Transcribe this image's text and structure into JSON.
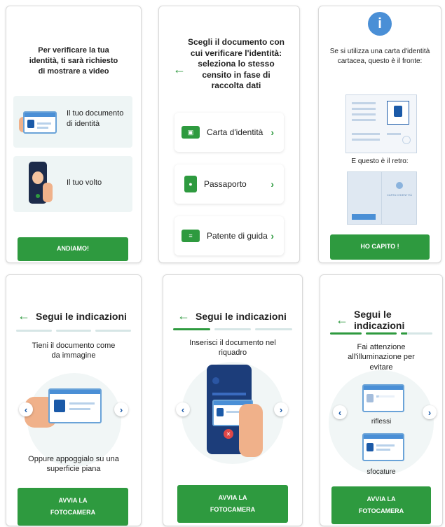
{
  "screens": {
    "s1": {
      "intro": "Per verificare la tua identità, ti sarà richiesto di mostrare a video",
      "item1": "Il tuo documento di identità",
      "item2": "Il tuo volto",
      "button": "ANDIAMO!"
    },
    "s2": {
      "title": "Scegli il documento con cui verificare l'identità: seleziona lo stesso censito in fase di raccolta dati",
      "docs": [
        "Carta d'identità",
        "Passaporto",
        "Patente di guida"
      ]
    },
    "s3": {
      "info_icon": "i",
      "text_front": "Se si utilizza una carta d'identità cartacea, questo è il fronte:",
      "text_back": "E questo è il retro:",
      "back_card_label": "CARTA D'IDENTITÀ",
      "button": "HO CAPITO !"
    },
    "s4": {
      "header": "Segui le indicazioni",
      "text1": "Tieni il documento come da immagine",
      "text2": "Oppure appoggialo su una superficie piana",
      "button_line1": "AVVIA LA",
      "button_line2": "FOTOCAMERA"
    },
    "s5": {
      "header": "Segui le indicazioni",
      "text1": "Inserisci il documento nel riquadro",
      "button_line1": "AVVIA LA",
      "button_line2": "FOTOCAMERA"
    },
    "s6": {
      "header": "Segui le indicazioni",
      "text1": "Fai attenzione all'illuminazione per evitare",
      "label1": "riflessi",
      "label2": "sfocature",
      "button_line1": "AVVIA LA",
      "button_line2": "FOTOCAMERA"
    }
  },
  "icons": {
    "back": "←",
    "chevron": "›",
    "prev": "‹",
    "next": "›",
    "close": "✕"
  },
  "colors": {
    "accent": "#2e9a3f",
    "blue": "#1b5aa8"
  }
}
